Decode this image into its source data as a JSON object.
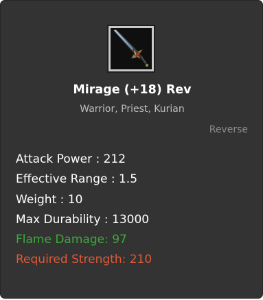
{
  "item": {
    "icon": "sword-icon",
    "name": "Mirage (+18) Rev",
    "classes": "Warrior, Priest, Kurian",
    "reverse_label": "Reverse"
  },
  "stats": [
    {
      "text": "Attack Power : 212",
      "color": "#ffffff"
    },
    {
      "text": "Effective Range : 1.5",
      "color": "#ffffff"
    },
    {
      "text": "Weight : 10",
      "color": "#ffffff"
    },
    {
      "text": "Max Durability : 13000",
      "color": "#ffffff"
    },
    {
      "text": "Flame Damage: 97",
      "color": "#3ea83b"
    },
    {
      "text": "Required Strength: 210",
      "color": "#e05a36"
    }
  ],
  "colors": {
    "panel_background": "#333333",
    "secondary_text": "#bdbdbd",
    "muted_text": "#8a8a8a"
  }
}
